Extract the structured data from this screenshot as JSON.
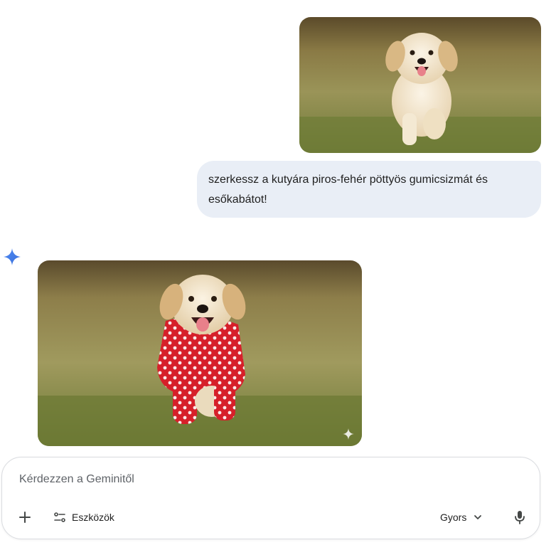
{
  "conversation": {
    "user_message": {
      "image_alt": "golden retriever puppy running on grass",
      "text": "szerkessz a kutyára piros-fehér pöttyös gumicsizmát és esőkabátot!"
    },
    "model_response": {
      "avatar_icon": "gemini-spark-icon",
      "image_alt": "puppy wearing red and white polka dot raincoat",
      "watermark_icon": "sparkle-icon"
    }
  },
  "composer": {
    "placeholder": "Kérdezzen a Geminitől",
    "add_icon": "plus-icon",
    "tools_label": "Eszközök",
    "tools_icon": "tune-icon",
    "mode_label": "Gyors",
    "mode_icon": "chevron-down-icon",
    "mic_icon": "mic-icon"
  },
  "colors": {
    "user_bubble": "#e9eef6",
    "gemini_blue": "#4285f4",
    "text": "#1f1f1f",
    "placeholder": "#5f6368"
  }
}
